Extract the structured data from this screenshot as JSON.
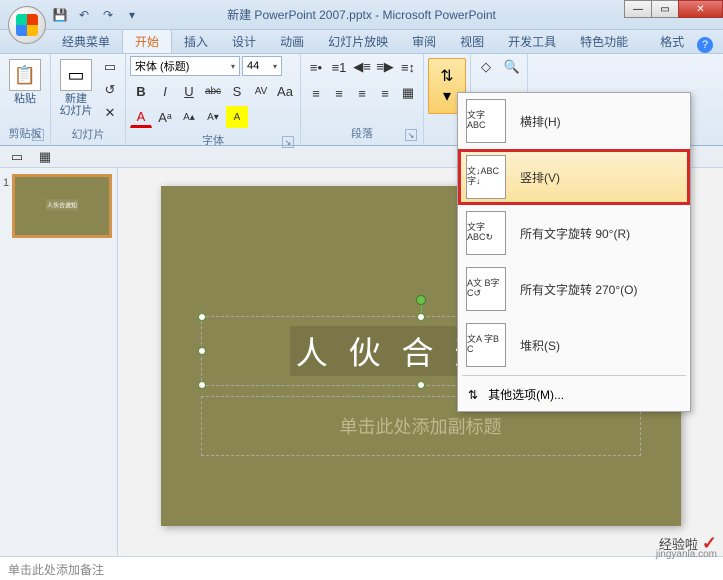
{
  "window": {
    "title": "新建 PowerPoint 2007.pptx - Microsoft PowerPoint",
    "min": "—",
    "max": "▭",
    "close": "✕"
  },
  "qat": {
    "save": "💾",
    "undo": "↶",
    "redo": "↷",
    "more": "▾"
  },
  "tabs": {
    "classic": "经典菜单",
    "home": "开始",
    "insert": "插入",
    "design": "设计",
    "anim": "动画",
    "slideshow": "幻灯片放映",
    "review": "审阅",
    "view": "视图",
    "dev": "开发工具",
    "feature": "特色功能",
    "format": "格式"
  },
  "ribbon": {
    "clipboard": {
      "paste": "粘贴",
      "label": "剪贴板"
    },
    "slides": {
      "new_slide": "新建\n幻灯片",
      "label": "幻灯片"
    },
    "font": {
      "name": "宋体 (标题)",
      "size": "44",
      "bold": "B",
      "italic": "I",
      "underline": "U",
      "strike": "abc",
      "shadow": "S",
      "spacing": "AV",
      "clear": "Aᵃ",
      "case": "Aa",
      "grow": "A▴",
      "shrink": "A▾",
      "color": "A",
      "highlight": "A",
      "label": "字体"
    },
    "paragraph": {
      "bullets": "≡•",
      "numbering": "≡1",
      "indent_dec": "◀≡",
      "indent_inc": "≡▶",
      "linespace": "≡↕",
      "align_l": "≡",
      "align_c": "≡",
      "align_r": "≡",
      "align_j": "≡",
      "columns": "▦",
      "label": "段落"
    },
    "textdir": {
      "icon": "⇅",
      "arrow": "▾"
    },
    "editing": {
      "find": "🔍",
      "replace": "ab",
      "select": "▭"
    }
  },
  "dropdown": {
    "items": [
      {
        "thumb": "文字\nABC",
        "label": "横排(H)"
      },
      {
        "thumb": "文↓ABC\n字↓",
        "label": "竖排(V)",
        "highlighted": true
      },
      {
        "thumb": "文字\nABC↻",
        "label": "所有文字旋转 90°(R)"
      },
      {
        "thumb": "A文\nB字\nC↺",
        "label": "所有文字旋转 270°(O)"
      },
      {
        "thumb": "文A\n字B\n C",
        "label": "堆积(S)"
      }
    ],
    "more_icon": "⇅",
    "more": "其他选项(M)..."
  },
  "thumb": {
    "num": "1",
    "preview": "人伙合道知"
  },
  "slide": {
    "title_text": "人 伙 合 道 知",
    "subtitle_placeholder": "单击此处添加副标题"
  },
  "notes": {
    "placeholder": "单击此处添加备注"
  },
  "watermark": {
    "brand": "经验啦",
    "url": "jingyanla.com"
  }
}
